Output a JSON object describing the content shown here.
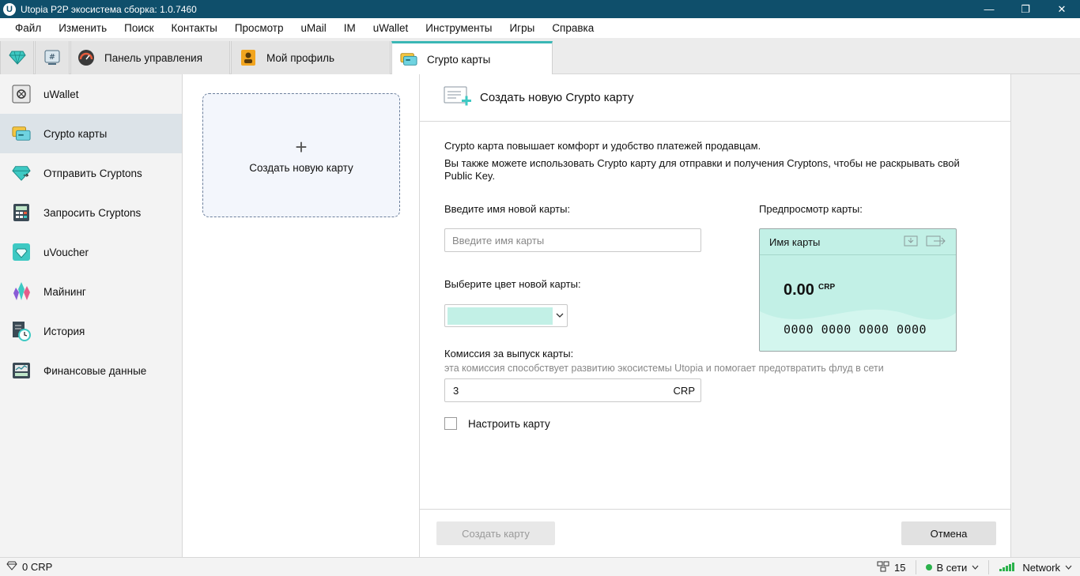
{
  "window": {
    "title": "Utopia P2P экосистема сборка: 1.0.7460",
    "app_icon_letter": "U",
    "minimize": "—",
    "maximize": "❐",
    "close": "✕"
  },
  "menu": [
    "Файл",
    "Изменить",
    "Поиск",
    "Контакты",
    "Просмотр",
    "uMail",
    "IM",
    "uWallet",
    "Инструменты",
    "Игры",
    "Справка"
  ],
  "tabs": [
    {
      "label": "Панель управления",
      "icon": "speedometer-icon"
    },
    {
      "label": "Мой профиль",
      "icon": "profile-icon"
    },
    {
      "label": "Crypto карты",
      "icon": "crypto-card-icon",
      "active": true
    }
  ],
  "sidebar": {
    "items": [
      {
        "label": "uWallet",
        "icon": "safe-icon"
      },
      {
        "label": "Crypto карты",
        "icon": "crypto-card-icon",
        "active": true
      },
      {
        "label": "Отправить Cryptons",
        "icon": "diamond-send-icon"
      },
      {
        "label": "Запросить Cryptons",
        "icon": "calculator-icon"
      },
      {
        "label": "uVoucher",
        "icon": "voucher-icon"
      },
      {
        "label": "Майнинг",
        "icon": "crystal-icon"
      },
      {
        "label": "История",
        "icon": "history-icon"
      },
      {
        "label": "Финансовые данные",
        "icon": "chart-icon"
      }
    ]
  },
  "cards_panel": {
    "new_card_tile_label": "Создать новую карту",
    "plus": "+"
  },
  "form": {
    "header_title": "Создать новую Crypto карту",
    "description_1": "Crypto карта повышает комфорт и удобство платежей продавцам.",
    "description_2": "Вы также можете использовать Crypto карту для отправки и получения Cryptons, чтобы не раскрывать свой Public Key.",
    "name_label": "Введите имя новой карты:",
    "name_placeholder": "Введите имя карты",
    "name_value": "",
    "color_label": "Выберите цвет новой карты:",
    "color_value": "#c2f0e6",
    "fee_label": "Комиссия за выпуск карты:",
    "fee_hint": "эта комиссия способствует развитию экосистемы Utopia и помогает предотвратить флуд в сети",
    "fee_value": "3",
    "fee_currency": "CRP",
    "customize_label": "Настроить карту",
    "customize_checked": false,
    "preview_label": "Предпросмотр карты:",
    "create_button": "Создать карту",
    "cancel_button": "Отмена"
  },
  "preview_card": {
    "name": "Имя карты",
    "balance": "0.00",
    "currency": "CRP",
    "number": "0000 0000 0000 0000"
  },
  "status": {
    "balance": "0 CRP",
    "peers": "15",
    "presence": "В сети",
    "network": "Network"
  },
  "colors": {
    "titlebar": "#0f4f6b",
    "accent": "#3ab7b5",
    "card_color": "#c2f0e6",
    "online": "#2bb24c"
  }
}
